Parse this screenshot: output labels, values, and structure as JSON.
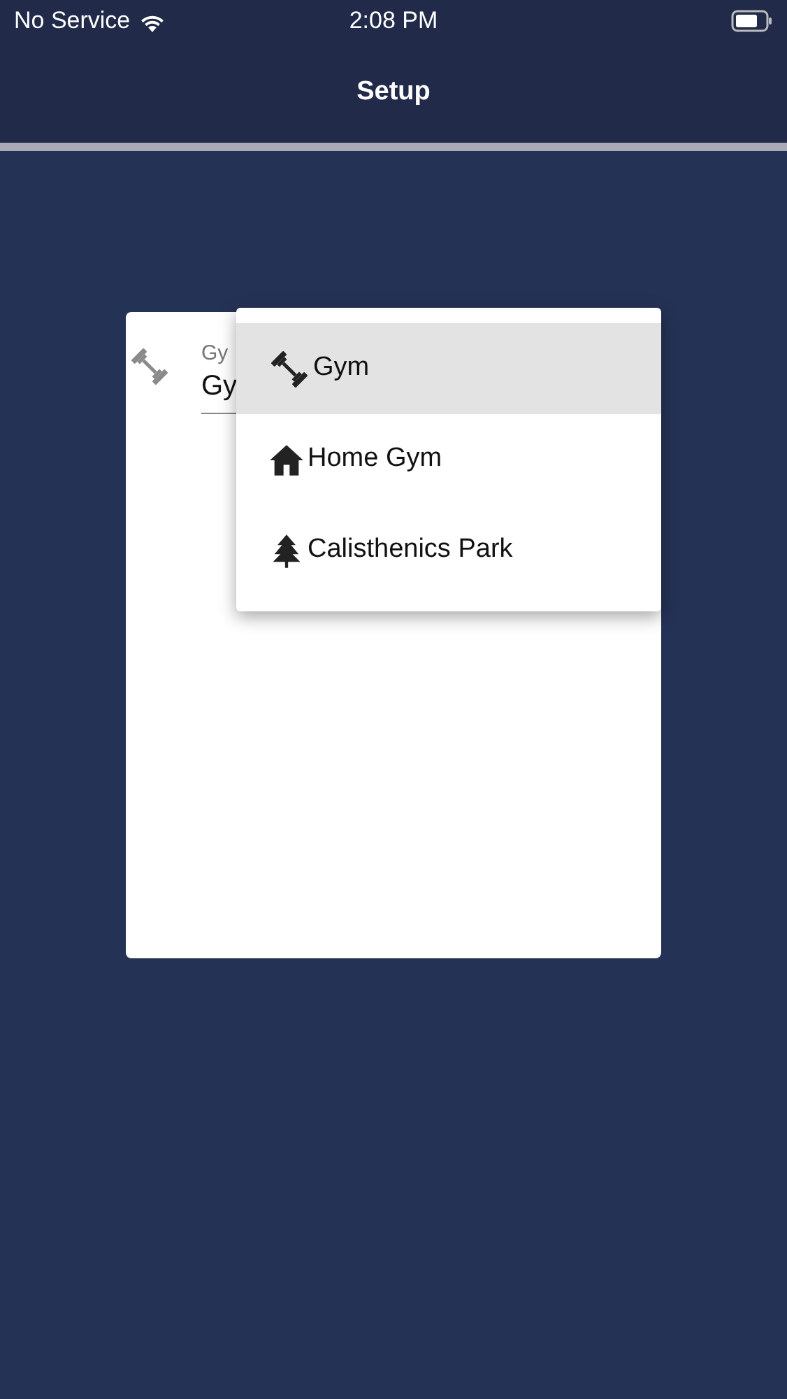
{
  "status_bar": {
    "carrier": "No Service",
    "time": "2:08 PM"
  },
  "header": {
    "title": "Setup"
  },
  "field": {
    "label": "Gy",
    "value": "Gy"
  },
  "menu": {
    "items": [
      {
        "label": "Gym",
        "selected": true
      },
      {
        "label": "Home Gym",
        "selected": false
      },
      {
        "label": "Calisthenics Park",
        "selected": false
      }
    ]
  }
}
